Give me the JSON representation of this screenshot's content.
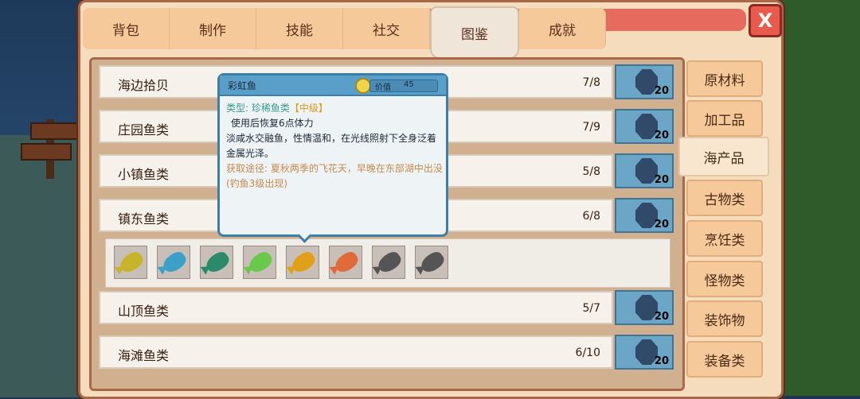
{
  "tabs": [
    "背包",
    "制作",
    "技能",
    "社交",
    "图鉴",
    "成就"
  ],
  "active_tab": "图鉴",
  "close_label": "X",
  "categories": [
    {
      "name": "海边拾贝",
      "count": "7/8",
      "reward": "20"
    },
    {
      "name": "庄园鱼类",
      "count": "7/9",
      "reward": "20"
    },
    {
      "name": "小镇鱼类",
      "count": "5/8",
      "reward": "20"
    },
    {
      "name": "镇东鱼类",
      "count": "6/8",
      "reward": "20"
    },
    {
      "name": "山顶鱼类",
      "count": "5/7",
      "reward": "20"
    },
    {
      "name": "海滩鱼类",
      "count": "6/10",
      "reward": "20"
    }
  ],
  "sidebar": [
    "原材料",
    "加工品",
    "海产品",
    "古物类",
    "烹饪类",
    "怪物类",
    "装饰物",
    "装备类"
  ],
  "active_sidebar": "海产品",
  "fish_slots": [
    {
      "color": "#c8b42a",
      "state": "collected"
    },
    {
      "color": "#3aa0c8",
      "state": "collected"
    },
    {
      "color": "#2a8a6a",
      "state": "collected"
    },
    {
      "color": "#6ac84a",
      "state": "collected"
    },
    {
      "color": "#e0a01a",
      "state": "collected"
    },
    {
      "color": "#e06a3a",
      "state": "collected"
    },
    {
      "color": "#555555",
      "state": "unknown"
    },
    {
      "color": "#555555",
      "state": "unknown"
    }
  ],
  "tooltip": {
    "name": "彩虹鱼",
    "value_label": "价值",
    "value": "45",
    "type_text": "类型: 珍稀鱼类",
    "grade_text": "【中级】",
    "effect": "使用后恢复6点体力",
    "description": "淡咸水交融鱼，性情温和，在光线照射下全身泛着金属光泽。",
    "source": "获取途径: 夏秋两季的飞花天，早晚在东部湖中出没(钓鱼3级出现)"
  }
}
